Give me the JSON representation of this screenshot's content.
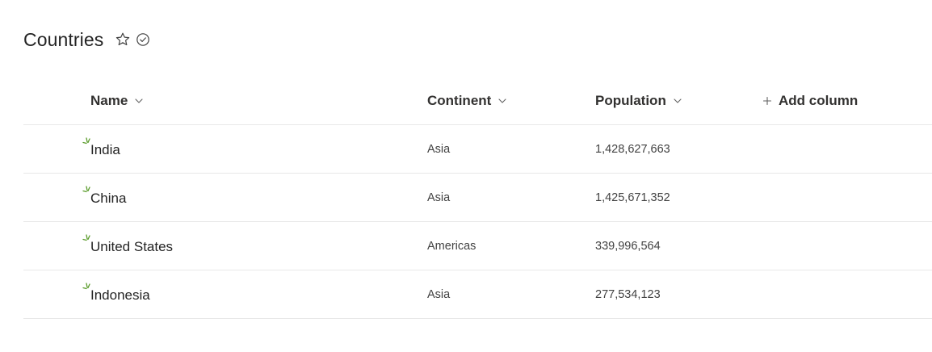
{
  "page": {
    "title": "Countries"
  },
  "columns": {
    "name": "Name",
    "continent": "Continent",
    "population": "Population",
    "add_column": "Add column"
  },
  "rows": [
    {
      "name": "India",
      "continent": "Asia",
      "population": "1,428,627,663"
    },
    {
      "name": "China",
      "continent": "Asia",
      "population": "1,425,671,352"
    },
    {
      "name": "United States",
      "continent": "Americas",
      "population": "339,996,564"
    },
    {
      "name": "Indonesia",
      "continent": "Asia",
      "population": "277,534,123"
    }
  ],
  "icons": {
    "favorite": "star-outline-icon",
    "follow": "circle-check-icon",
    "sort": "chevron-down-icon",
    "add": "plus-icon",
    "new_item": "new-item-burst-icon"
  },
  "colors": {
    "text": "#242424",
    "muted": "#424242",
    "new_item_accent": "#5b9c2c",
    "divider": "#e8e8e8"
  }
}
